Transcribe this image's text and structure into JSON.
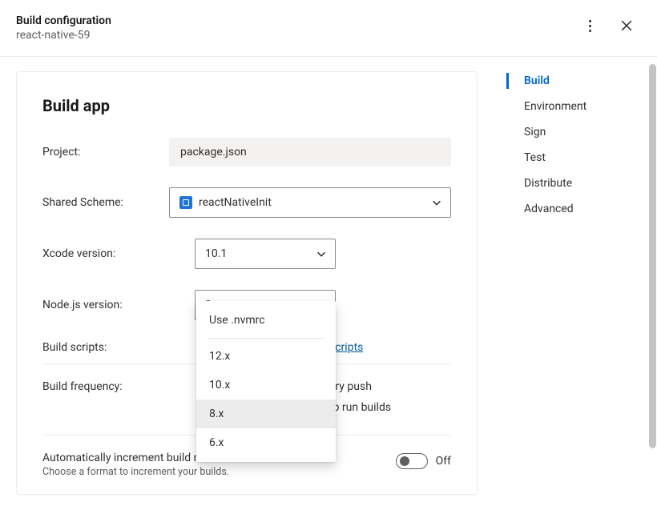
{
  "header": {
    "title": "Build configuration",
    "subtitle": "react-native-59"
  },
  "main": {
    "heading": "Build app",
    "fields": {
      "project": {
        "label": "Project:",
        "value": "package.json"
      },
      "sharedScheme": {
        "label": "Shared Scheme:",
        "value": "reactNativeInit"
      },
      "xcodeVersion": {
        "label": "Xcode version:",
        "value": "10.1"
      },
      "nodeVersion": {
        "label": "Node.js version:",
        "value": "8.x"
      },
      "buildScripts": {
        "label": "Build scripts:",
        "linkSuffix": "scripts"
      },
      "buildFrequency": {
        "label": "Build frequency:",
        "opt1": "ery push",
        "opt2": "to run builds"
      },
      "autoIncrement": {
        "title": "Automatically increment build number",
        "subtitle": "Choose a format to increment your builds.",
        "stateLabel": "Off"
      }
    },
    "nodeDropdown": {
      "options": [
        "Use .nvmrc",
        "12.x",
        "10.x",
        "8.x",
        "6.x"
      ],
      "selected": "8.x"
    }
  },
  "sidenav": {
    "items": [
      "Build",
      "Environment",
      "Sign",
      "Test",
      "Distribute",
      "Advanced"
    ],
    "activeIndex": 0
  }
}
